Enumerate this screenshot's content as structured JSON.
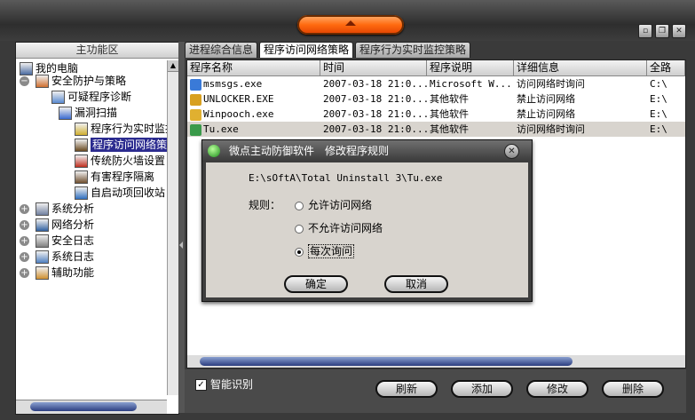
{
  "left_panel": {
    "title": "主功能区",
    "tree": [
      {
        "label": "我的电脑",
        "icon": "computer-icon",
        "expander": ""
      },
      {
        "label": "安全防护与策略",
        "icon": "shield-policy-icon",
        "expander": "−"
      },
      {
        "label": "可疑程序诊断",
        "icon": "diagnose-icon",
        "expander": ""
      },
      {
        "label": "漏洞扫描",
        "icon": "magnifier-icon",
        "expander": ""
      },
      {
        "label": "程序行为实时监控策",
        "icon": "monitor-icon",
        "expander": ""
      },
      {
        "label": "程序访问网络策略",
        "icon": "network-policy-icon",
        "expander": "",
        "selected": true
      },
      {
        "label": "传统防火墙设置",
        "icon": "firewall-icon",
        "expander": ""
      },
      {
        "label": "有害程序隔离",
        "icon": "quarantine-icon",
        "expander": ""
      },
      {
        "label": "自启动项回收站",
        "icon": "recycle-icon",
        "expander": ""
      },
      {
        "label": "系统分析",
        "icon": "system-analysis-icon",
        "expander": "+"
      },
      {
        "label": "网络分析",
        "icon": "network-analysis-icon",
        "expander": "+"
      },
      {
        "label": "安全日志",
        "icon": "security-log-icon",
        "expander": "+"
      },
      {
        "label": "系统日志",
        "icon": "system-log-icon",
        "expander": "+"
      },
      {
        "label": "辅助功能",
        "icon": "helper-icon",
        "expander": "+"
      }
    ]
  },
  "tabs": [
    {
      "label": "进程综合信息",
      "active": false
    },
    {
      "label": "程序访问网络策略",
      "active": true
    },
    {
      "label": "程序行为实时监控策略",
      "active": false
    }
  ],
  "table": {
    "columns": [
      "程序名称",
      "时间",
      "程序说明",
      "详细信息",
      "全路"
    ],
    "rows": [
      {
        "name": "msmsgs.exe",
        "time": "2007-03-18 21:0...",
        "desc": "Microsoft W...",
        "detail": "访问网络时询问",
        "path": "C:\\",
        "icon_color": "#3a7ad8"
      },
      {
        "name": "UNLOCKER.EXE",
        "time": "2007-03-18 21:0...",
        "desc": "其他软件",
        "detail": "禁止访问网络",
        "path": "E:\\",
        "icon_color": "#d8a020"
      },
      {
        "name": "Winpooch.exe",
        "time": "2007-03-18 21:0...",
        "desc": "其他软件",
        "detail": "禁止访问网络",
        "path": "E:\\",
        "icon_color": "#e0b030"
      },
      {
        "name": "Tu.exe",
        "time": "2007-03-18 21:0...",
        "desc": "其他软件",
        "detail": "访问网络时询问",
        "path": "E:\\",
        "icon_color": "#3a9a4a",
        "selected": true
      }
    ]
  },
  "bottom": {
    "smart_label": "智能识别",
    "smart_checked": "✓",
    "refresh": "刷新",
    "add": "添加",
    "modify": "修改",
    "delete": "删除"
  },
  "dialog": {
    "title": "微点主动防御软件　修改程序规则",
    "close": "✕",
    "path": "E:\\sOftA\\Total Uninstall 3\\Tu.exe",
    "rule_label": "规则：",
    "options": [
      {
        "label": "允许访问网络",
        "checked": false
      },
      {
        "label": "不允许访问网络",
        "checked": false
      },
      {
        "label": "每次询问",
        "checked": true
      }
    ],
    "ok": "确定",
    "cancel": "取消"
  }
}
